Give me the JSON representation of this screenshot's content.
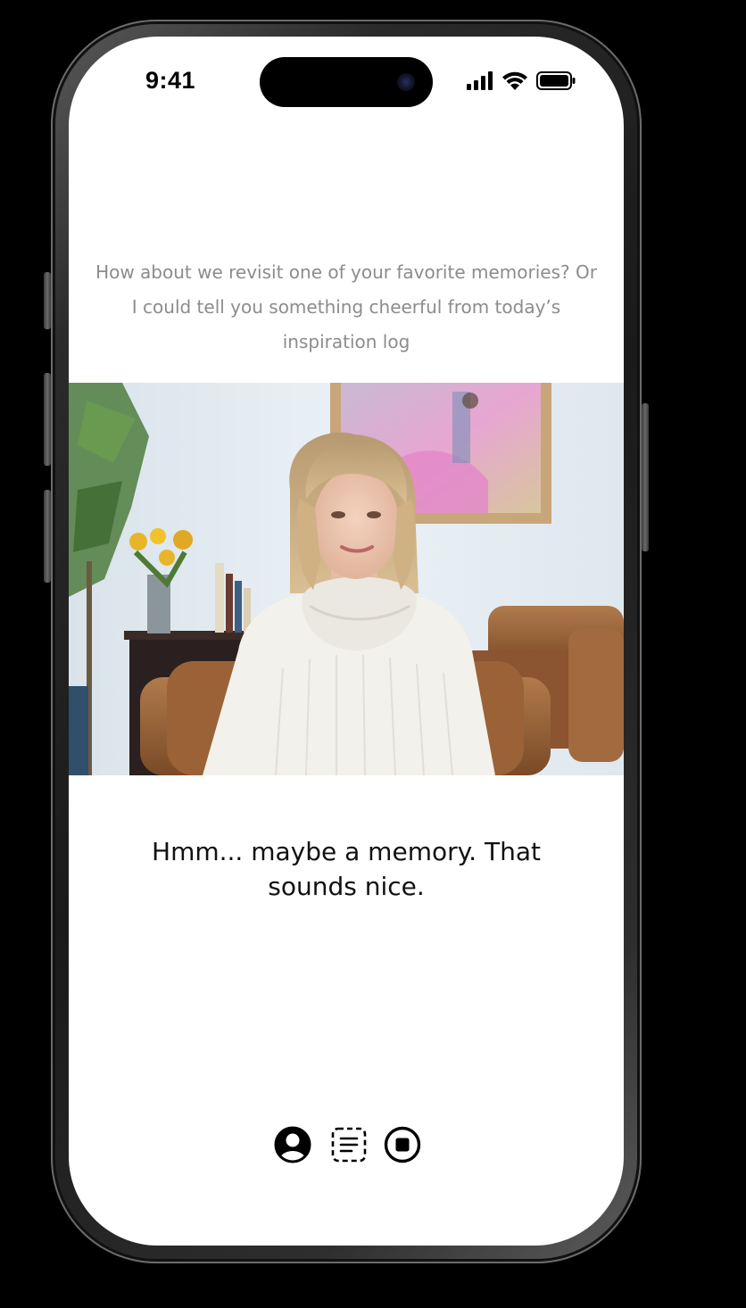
{
  "status_bar": {
    "time": "9:41",
    "icons": [
      "cellular-signal-icon",
      "wifi-icon",
      "battery-icon"
    ]
  },
  "conversation": {
    "assistant_prompt": "How about we revisit one of your favorite memories? Or I could tell you something cheerful from today’s inspiration log",
    "user_response": "Hmm... maybe a memory. That sounds nice."
  },
  "controls": [
    {
      "name": "profile-button",
      "icon": "user-circle-icon"
    },
    {
      "name": "transcript-button",
      "icon": "transcript-lines-icon"
    },
    {
      "name": "stop-button",
      "icon": "stop-circle-icon"
    }
  ],
  "colors": {
    "screen_background": "#ffffff",
    "prompt_text": "#8c8c8c",
    "response_text": "#111111",
    "icon": "#000000"
  }
}
